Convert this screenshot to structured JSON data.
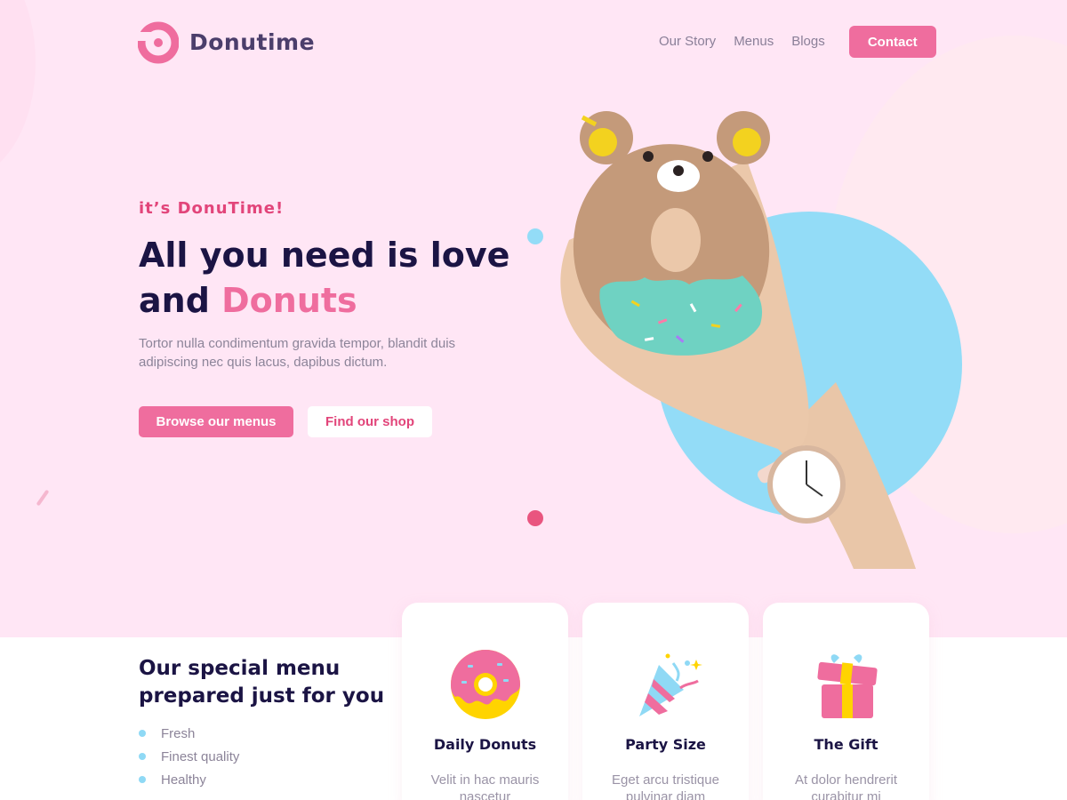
{
  "brand": {
    "name": "Donutime"
  },
  "nav": {
    "links": [
      "Our Story",
      "Menus",
      "Blogs"
    ],
    "contact_label": "Contact"
  },
  "hero": {
    "tagline": "it’s DonuTime!",
    "headline_part1": "All you need is love",
    "headline_part2": "and ",
    "headline_accent": "Donuts",
    "description": "Tortor nulla condimentum gravida tempor, blandit duis adipiscing nec quis lacus, dapibus dictum.",
    "primary_button": "Browse our menus",
    "secondary_button": "Find our shop"
  },
  "menu_section": {
    "heading": "Our special menu prepared just for you",
    "features": [
      "Fresh",
      "Finest quality",
      "Healthy"
    ]
  },
  "cards": [
    {
      "title": "Daily Donuts",
      "description": "Velit in hac mauris nascetur",
      "icon": "donut-icon"
    },
    {
      "title": "Party Size",
      "description": "Eget arcu tristique pulvinar diam",
      "icon": "party-popper-icon"
    },
    {
      "title": "The Gift",
      "description": "At dolor hendrerit curabitur mi",
      "icon": "gift-icon"
    }
  ],
  "colors": {
    "accent": "#ef6d9e",
    "heading": "#1b1444",
    "hero_bg": "#ffe6f5",
    "bubble": "#93dcf7"
  }
}
